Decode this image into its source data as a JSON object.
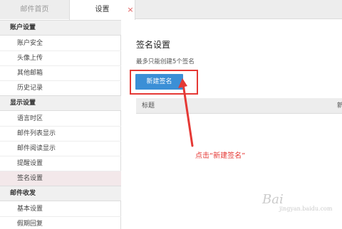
{
  "tabs": {
    "home_label": "邮件首页",
    "settings_label": "设置",
    "close_glyph": "×"
  },
  "sidebar": {
    "groups": [
      {
        "label": "账户设置",
        "items": [
          "账户安全",
          "头像上传",
          "其他邮箱",
          "历史记录"
        ]
      },
      {
        "label": "显示设置",
        "items": [
          "语言时区",
          "邮件列表显示",
          "邮件阅读显示",
          "提醒设置",
          "签名设置"
        ]
      },
      {
        "label": "邮件收发",
        "items": [
          "基本设置",
          "假期回复"
        ]
      }
    ],
    "active_item": "签名设置"
  },
  "main": {
    "title": "签名设置",
    "hint": "最多只能创建5个签名",
    "new_button": "新建签名",
    "table": {
      "col_title": "标题",
      "col_new": "新"
    }
  },
  "annotation": {
    "text": "点击“新建签名”",
    "color": "#e53935"
  },
  "watermark": {
    "text": "Bai",
    "sub": "jingyan.baidu.com"
  }
}
